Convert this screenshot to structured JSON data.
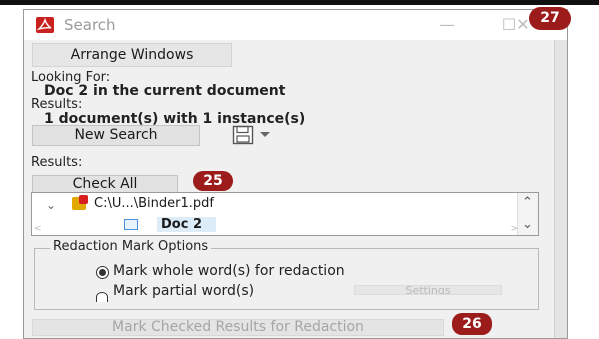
{
  "window": {
    "title": "Search",
    "min_glyph": "—",
    "max_glyph": "☐",
    "close_glyph": "✕"
  },
  "toolbar": {
    "arrange_windows": "Arrange Windows"
  },
  "search_info": {
    "looking_for_label": "Looking For:",
    "looking_for_value": "Doc 2 in the current document",
    "results_label": "Results:",
    "results_value": "1 document(s) with 1 instance(s)"
  },
  "actions": {
    "new_search": "New Search",
    "check_all": "Check All"
  },
  "results_section_label": "Results:",
  "results_tree": {
    "file": "C:\\U...\\Binder1.pdf",
    "match": "Doc 2"
  },
  "redaction_options": {
    "title": "Redaction Mark Options",
    "option_whole": "Mark whole word(s) for redaction",
    "option_partial": "Mark partial word(s)",
    "settings": "Settings",
    "selected": "whole"
  },
  "footer": {
    "mark_checked": "Mark Checked Results for Redaction"
  },
  "badges": [
    "25",
    "26",
    "27"
  ],
  "icons": [
    "acrobat-icon",
    "save-icon",
    "pdf-file-icon",
    "document-icon",
    "chevron-down-icon"
  ],
  "colors": {
    "badge": "#9c1b1b",
    "window_bg": "#f0f0f0",
    "acrobat_red": "#c9211e"
  }
}
